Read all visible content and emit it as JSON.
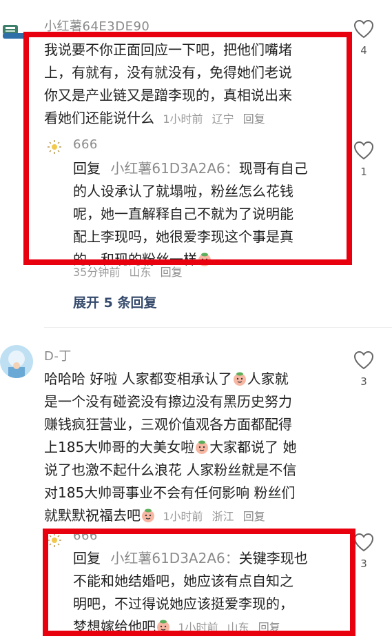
{
  "comments": [
    {
      "username": "小红薯64E3DE90",
      "lines": [
        "我说要不你正面回应一下吧，把他们嘴堵",
        "上，有就有，没有就没有，免得她们老说",
        "你又是产业链又是蹭李现的，真相说出来"
      ],
      "last_line": "看她们还能说什么",
      "meta_time": "1小时前",
      "meta_loc": "辽宁",
      "meta_reply": "回复",
      "likes": "4",
      "replies": [
        {
          "username": "666",
          "reply_prefix": "回复",
          "reply_target": "小红薯61D3A2A6：",
          "first_line_rest": "现哥有自己",
          "lines": [
            "的人设承认了就塌啦，粉丝怎么花钱",
            "呢，她一直解释自己不就为了说明能",
            "配上李现吗，她很爱李现这个事是真"
          ],
          "last_line": "的，和现的粉丝一样",
          "meta_time": "35分钟前",
          "meta_loc": "山东",
          "meta_reply": "回复",
          "likes": "1"
        }
      ],
      "expand_label": "展开 5 条回复"
    },
    {
      "username": "D-丁",
      "first_line_a": "哈哈哈 好啦 人家都变相承认了",
      "first_line_b": "人家就",
      "lines": [
        "是一个没有碰瓷没有擦边没有黑历史努力",
        "赚钱疯狂营业，三观价值观各方面都配得"
      ],
      "line4a": "上185大帅哥的大美女啦",
      "line4b": "大家都说了 她",
      "lines2": [
        "说了也激不起什么浪花 人家粉丝就是不信",
        "对185大帅哥事业不会有任何影响 粉丝们"
      ],
      "last_line": "就默默祝福去吧",
      "meta_time": "1小时前",
      "meta_loc": "浙江",
      "meta_reply": "回复",
      "likes": "3",
      "replies": [
        {
          "username": "666",
          "reply_prefix": "回复",
          "reply_target": "小红薯61D3A2A6：",
          "first_line_rest": "关键李现也",
          "lines": [
            "不能和她结婚吧，她应该有点自知之",
            "明吧，不过得说她应该挺爱李现的，"
          ],
          "last_line": "梦想嫁给他吧",
          "meta_time": "1小时前",
          "meta_loc": "山东",
          "meta_reply": "回复",
          "likes": "3"
        }
      ]
    }
  ],
  "colors": {
    "highlight_border": "#e8000f",
    "link": "#34496b",
    "muted": "#9a9a9a"
  },
  "icons": [
    "heart-outline-icon",
    "peach-emoji-icon",
    "sun-avatar-icon",
    "sneaker-avatar-icon"
  ]
}
